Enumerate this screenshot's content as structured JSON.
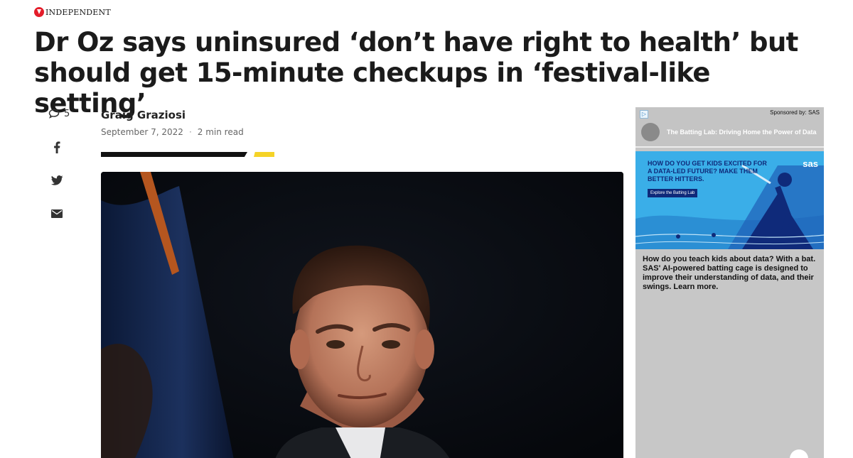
{
  "site": {
    "logo": "INDEPENDENT"
  },
  "article": {
    "headline": "Dr Oz says uninsured ‘don’t have right to health’ but should get 15-minute checkups in ‘festival-like setting’",
    "author": "Graig Graziosi",
    "date": "September 7, 2022",
    "read_time": "2 min read",
    "comment_count": "5"
  },
  "share": {
    "icons": [
      "comment-icon",
      "facebook-icon",
      "twitter-icon",
      "email-icon"
    ]
  },
  "colors": {
    "accent": "#f5d327",
    "brand": "#e41d2a",
    "rule": "#111111"
  },
  "ad": {
    "choices_label": "▷",
    "sponsored": "Sponsored by: SAS",
    "title": "The Batting Lab: Driving Home the Power of Data",
    "headline": "HOW DO YOU GET KIDS EXCITED FOR A DATA-LED FUTURE? MAKE THEM BETTER HITTERS.",
    "cta": "Explore the Batting Lab",
    "brand": "sas",
    "body": "How do you teach kids about data? With a bat. SAS' AI-powered batting cage is designed to improve their understanding of data, and their swings. Learn more."
  }
}
